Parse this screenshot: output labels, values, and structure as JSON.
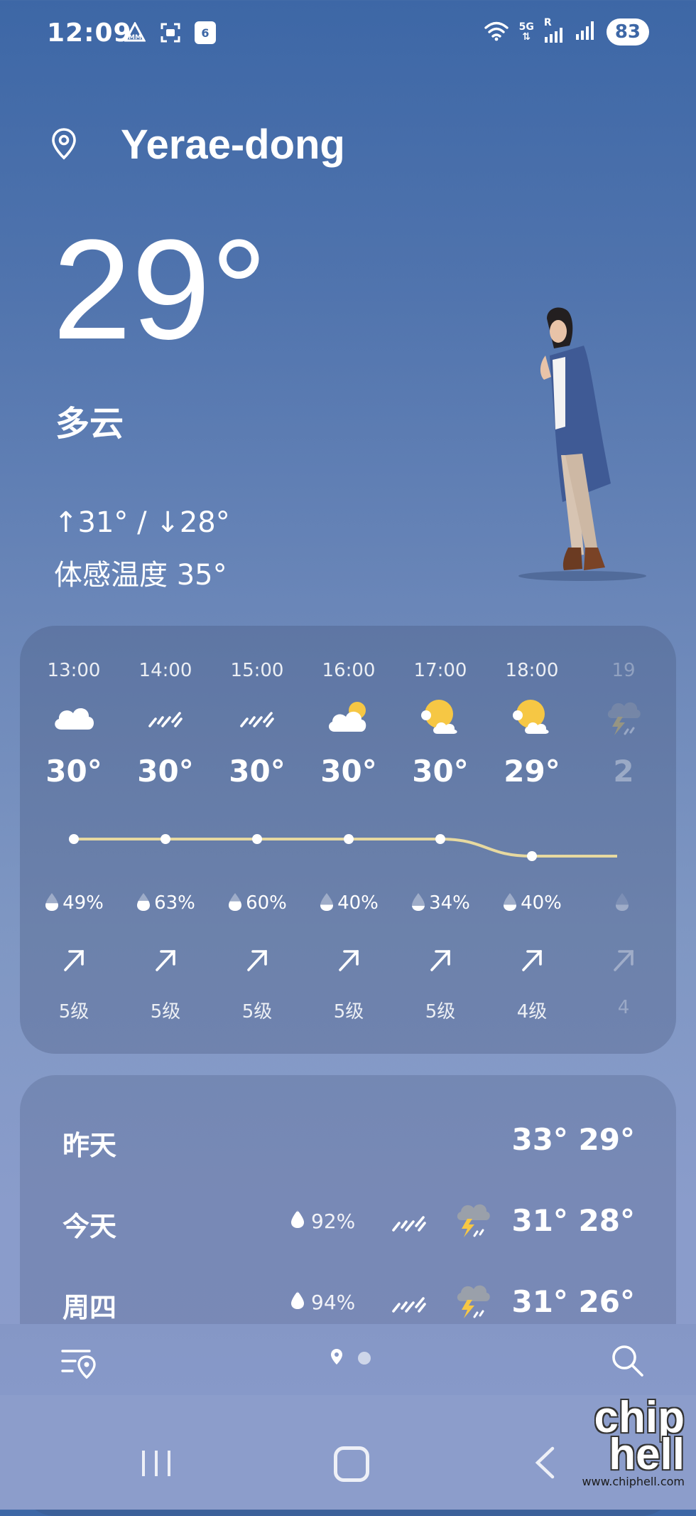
{
  "status": {
    "time": "12:09",
    "calendar_day": "6",
    "network": "5G",
    "roaming": "R",
    "battery": "83"
  },
  "location": {
    "name": "Yerae-dong"
  },
  "current": {
    "temperature": "29°",
    "condition": "多云",
    "high_low": "↑31° / ↓28°",
    "feels_like": "体感温度 35°"
  },
  "hourly": [
    {
      "time": "13:00",
      "icon": "cloudy-icon",
      "temp": "30°",
      "precip": "49%",
      "precip_fill": 0.49,
      "wind": "5级",
      "wind_dir": "north-east"
    },
    {
      "time": "14:00",
      "icon": "rain-icon",
      "temp": "30°",
      "precip": "63%",
      "precip_fill": 0.63,
      "wind": "5级",
      "wind_dir": "north-east"
    },
    {
      "time": "15:00",
      "icon": "rain-icon",
      "temp": "30°",
      "precip": "60%",
      "precip_fill": 0.6,
      "wind": "5级",
      "wind_dir": "north-east"
    },
    {
      "time": "16:00",
      "icon": "partly-cloudy-icon",
      "temp": "30°",
      "precip": "40%",
      "precip_fill": 0.4,
      "wind": "5级",
      "wind_dir": "north-east"
    },
    {
      "time": "17:00",
      "icon": "sun-cloud-icon",
      "temp": "30°",
      "precip": "34%",
      "precip_fill": 0.34,
      "wind": "5级",
      "wind_dir": "north-east"
    },
    {
      "time": "18:00",
      "icon": "sun-cloud-icon",
      "temp": "29°",
      "precip": "40%",
      "precip_fill": 0.4,
      "wind": "4级",
      "wind_dir": "north-east"
    },
    {
      "time": "19",
      "icon": "storm-icon",
      "temp": "2",
      "precip": "",
      "precip_fill": 0.4,
      "wind": "4",
      "wind_dir": "north-east"
    }
  ],
  "daily": [
    {
      "day": "昨天",
      "precip": "",
      "temps": "33° 29°",
      "show_icons": false
    },
    {
      "day": "今天",
      "precip": "92%",
      "temps": "31° 28°",
      "show_icons": true
    },
    {
      "day": "周四",
      "precip": "94%",
      "temps": "31° 26°",
      "show_icons": true
    }
  ],
  "watermark": {
    "logo": "chip hell",
    "url": "www.chiphell.com"
  },
  "colors": {
    "bg_top": "#3d67a6",
    "bg_bottom": "#8c9ccb",
    "temp_line_high": "#e7d9a0",
    "temp_line_low": "#d9d4c4",
    "sun": "#f6c744"
  }
}
